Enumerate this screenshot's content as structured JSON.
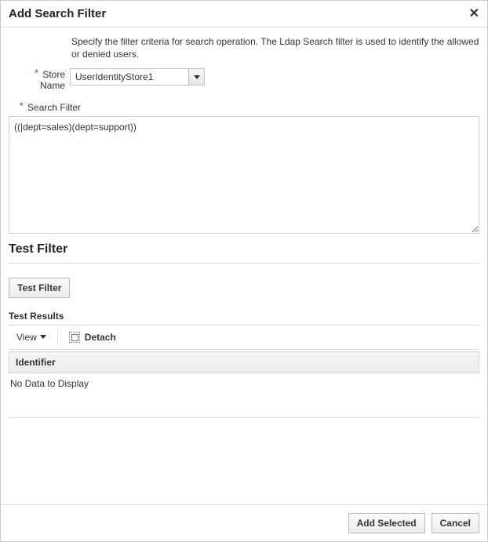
{
  "dialog": {
    "title": "Add Search Filter",
    "help_text": "Specify the filter criteria for search operation. The Ldap Search filter is used to identify the allowed or denied users."
  },
  "store": {
    "label_line1": "Store",
    "label_line2": "Name",
    "value": "UserIdentityStore1"
  },
  "search_filter": {
    "label": "Search Filter",
    "value": "((|dept=sales)(dept=support))"
  },
  "test_section": {
    "title": "Test Filter",
    "button": "Test Filter",
    "results_label": "Test Results"
  },
  "results_toolbar": {
    "view_label": "View",
    "detach_label": "Detach"
  },
  "grid": {
    "column_header": "Identifier",
    "empty_text": "No Data to Display"
  },
  "footer": {
    "add_selected": "Add Selected",
    "cancel": "Cancel"
  }
}
